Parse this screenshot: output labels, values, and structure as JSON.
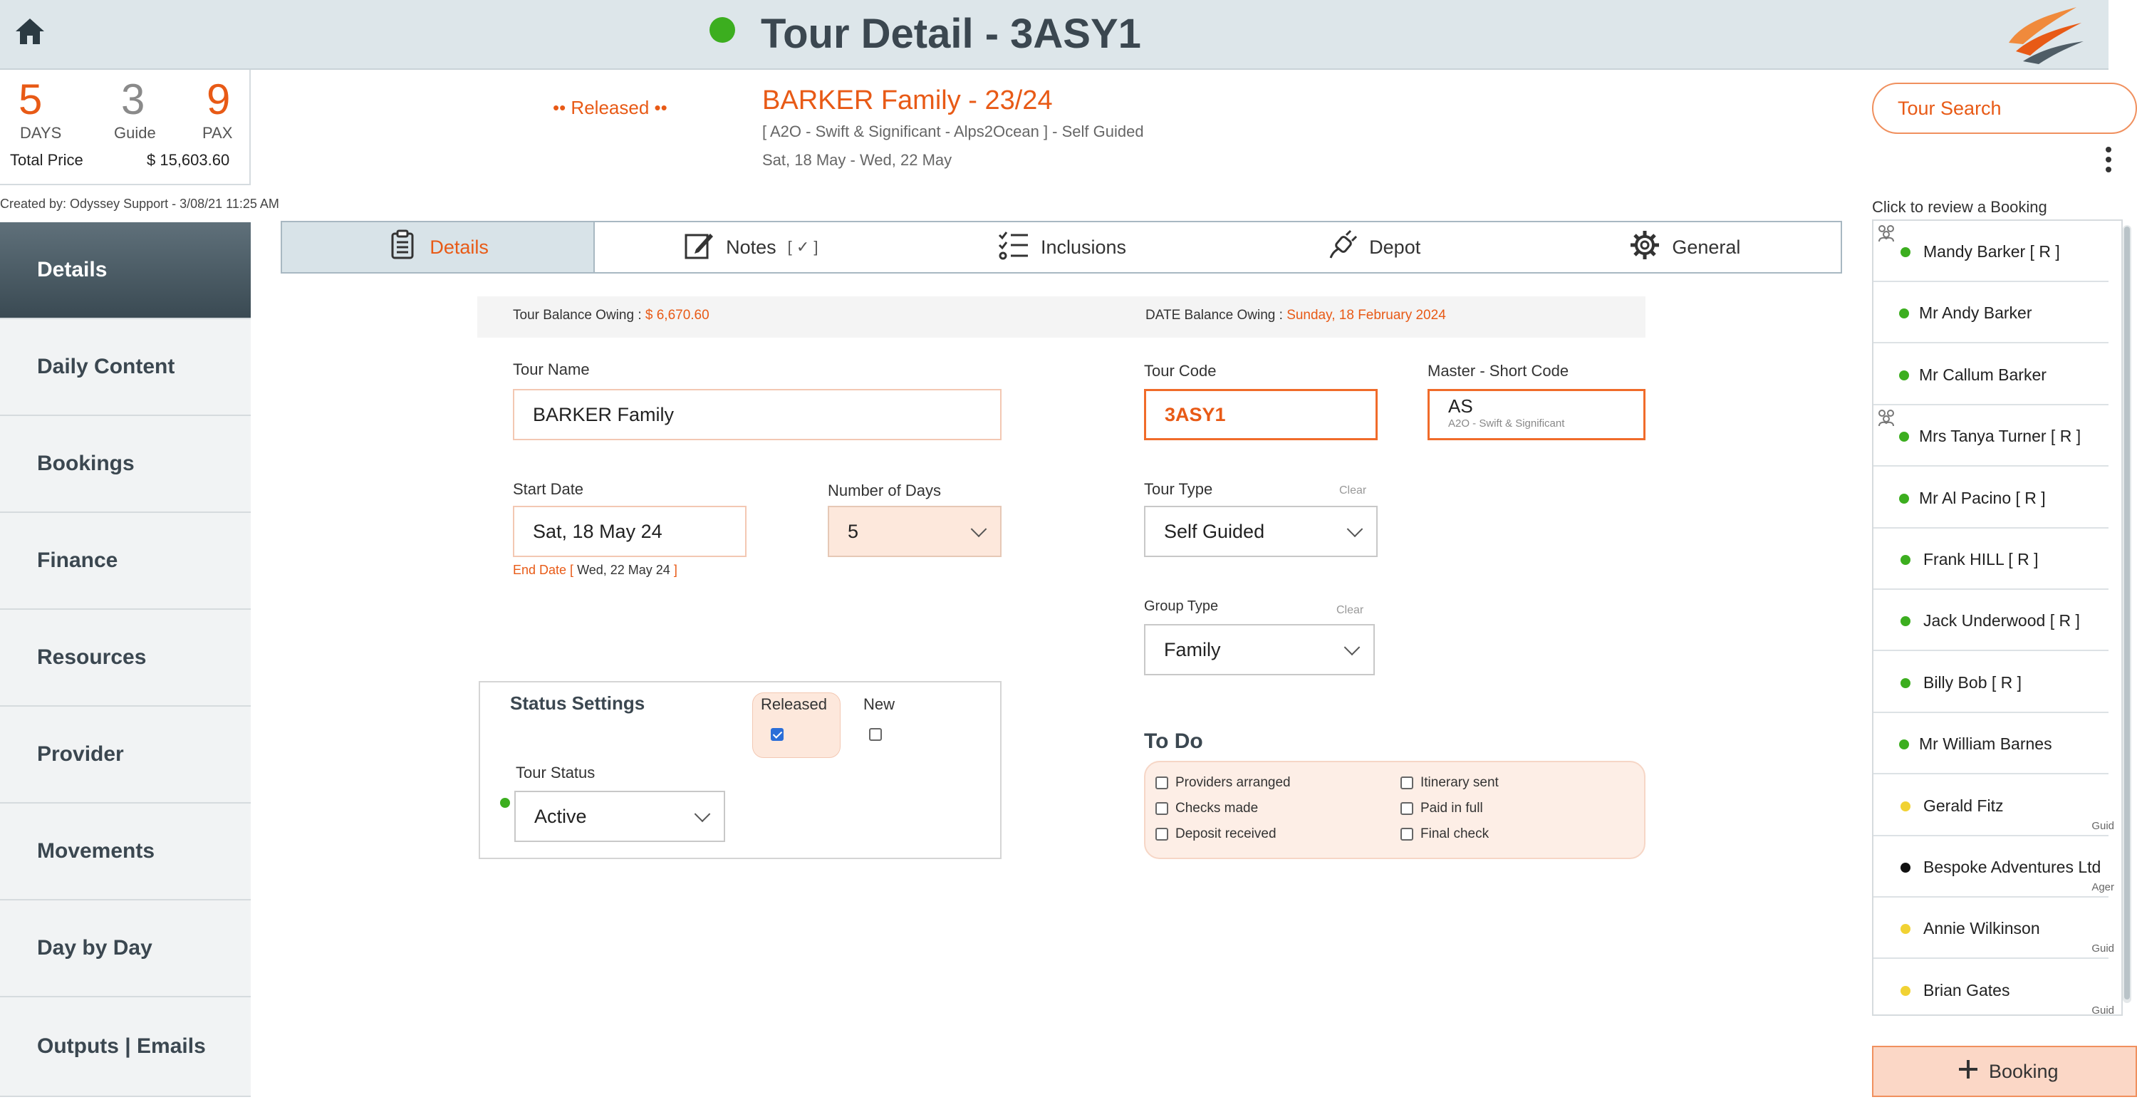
{
  "header": {
    "title": "Tour Detail - 3ASY1",
    "status_color": "#3cae1f"
  },
  "summary": {
    "days": "5",
    "days_label": "DAYS",
    "guide": "3",
    "guide_label": "Guide",
    "pax": "9",
    "pax_label": "PAX",
    "total_label": "Total Price",
    "total_value": "$ 15,603.60"
  },
  "created_by": "Created by: Odyssey Support - 3/08/21 11:25 AM",
  "tour_header": {
    "status_text": "•• Released ••",
    "heading": "BARKER Family - 23/24",
    "subtitle": "[ A2O - Swift & Significant - Alps2Ocean ] - Self Guided",
    "dates": "Sat, 18 May  - Wed, 22 May"
  },
  "sidebar": {
    "items": [
      {
        "label": "Details"
      },
      {
        "label": "Daily Content"
      },
      {
        "label": "Bookings"
      },
      {
        "label": "Finance"
      },
      {
        "label": "Resources"
      },
      {
        "label": "Provider"
      },
      {
        "label": "Movements"
      },
      {
        "label": "Day by Day"
      },
      {
        "label": "Outputs | Emails"
      }
    ]
  },
  "tabs": [
    {
      "label": "Details",
      "icon": "clipboard-icon"
    },
    {
      "label": "Notes",
      "mark": "[ ✓ ]",
      "icon": "edit-icon"
    },
    {
      "label": "Inclusions",
      "icon": "checklist-icon"
    },
    {
      "label": "Depot",
      "icon": "plug-icon"
    },
    {
      "label": "General",
      "icon": "gear-icon"
    }
  ],
  "balance": {
    "tour_label": "Tour Balance Owing : ",
    "tour_value": "$ 6,670.60",
    "date_label": "DATE Balance Owing : ",
    "date_value": "Sunday, 18 February 2024"
  },
  "form": {
    "tour_name_label": "Tour Name",
    "tour_name": "BARKER Family",
    "tour_code_label": "Tour Code",
    "tour_code": "3ASY1",
    "master_label": "Master - Short Code",
    "master_code": "AS",
    "master_desc": "A2O - Swift & Significant",
    "start_label": "Start Date",
    "start_date": "Sat, 18 May 24",
    "end_date_label": "End Date [",
    "end_date": " Wed, 22 May 24 ",
    "end_date_close": "]",
    "days_label": "Number of Days",
    "days_value": "5",
    "tour_type_label": "Tour Type",
    "tour_type": "Self Guided",
    "clear_label": "Clear",
    "group_type_label": "Group Type",
    "group_type": "Family"
  },
  "status_settings": {
    "title": "Status Settings",
    "released_label": "Released",
    "released_checked": true,
    "new_label": "New",
    "new_checked": false,
    "tour_status_label": "Tour Status",
    "tour_status": "Active"
  },
  "todo": {
    "title": "To Do",
    "items": [
      {
        "label": "Providers arranged",
        "checked": false
      },
      {
        "label": "Itinerary sent",
        "checked": false
      },
      {
        "label": "Checks made",
        "checked": false
      },
      {
        "label": "Paid in full",
        "checked": false
      },
      {
        "label": "Deposit received",
        "checked": false
      },
      {
        "label": "Final check",
        "checked": false
      }
    ]
  },
  "right_panel": {
    "search_label": "Tour Search",
    "review_label": "Click to review a Booking",
    "add_label": "Booking",
    "bookings": [
      {
        "name": "Mandy Barker  [ R ]",
        "dot": "#3cae1f",
        "group": true,
        "role": ""
      },
      {
        "name": "Mr Andy Barker",
        "dot": "#3cae1f",
        "group": false,
        "role": ""
      },
      {
        "name": "Mr Callum Barker",
        "dot": "#3cae1f",
        "group": false,
        "role": ""
      },
      {
        "name": "Mrs Tanya Turner  [ R ]",
        "dot": "#3cae1f",
        "group": true,
        "role": ""
      },
      {
        "name": "Mr Al Pacino  [ R ]",
        "dot": "#3cae1f",
        "group": false,
        "role": ""
      },
      {
        "name": "Frank HILL  [ R ]",
        "dot": "#3cae1f",
        "group": false,
        "role": ""
      },
      {
        "name": "Jack Underwood  [ R ]",
        "dot": "#3cae1f",
        "group": false,
        "role": ""
      },
      {
        "name": "Billy Bob  [ R ]",
        "dot": "#3cae1f",
        "group": false,
        "role": ""
      },
      {
        "name": "Mr William Barnes",
        "dot": "#3cae1f",
        "group": false,
        "role": ""
      },
      {
        "name": "Gerald Fitz",
        "dot": "#f1d233",
        "group": false,
        "role": "Guid"
      },
      {
        "name": "Bespoke Adventures Ltd",
        "dot": "#111111",
        "group": false,
        "role": "Ager"
      },
      {
        "name": "Annie Wilkinson",
        "dot": "#f1d233",
        "group": false,
        "role": "Guid"
      },
      {
        "name": "Brian Gates",
        "dot": "#f1d233",
        "group": false,
        "role": "Guid"
      }
    ]
  },
  "colors": {
    "accent": "#e85a16",
    "header_bg": "#dde6ea",
    "active_nav": "#3a4a53"
  }
}
